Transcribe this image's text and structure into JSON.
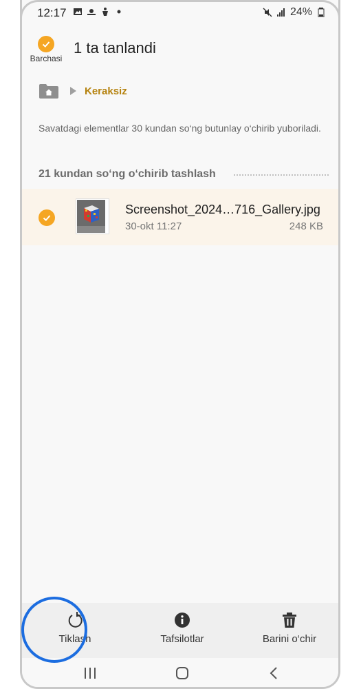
{
  "status_bar": {
    "time": "12:17",
    "battery": "24%",
    "left_icons": [
      "image-icon",
      "weather-icon",
      "accessibility-icon",
      "dot-icon"
    ],
    "right_icons": [
      "mute-icon",
      "signal-icon",
      "battery-icon"
    ]
  },
  "header": {
    "select_all_label": "Barchasi",
    "title": "1 ta tanlandi"
  },
  "breadcrumb": {
    "current": "Keraksiz"
  },
  "info_text": "Savatdagi elementlar 30 kundan so‘ng butunlay o‘chirib yuboriladi.",
  "section": {
    "heading": "21 kundan so‘ng o‘chirib tashlash"
  },
  "files": [
    {
      "name": "Screenshot_2024…716_Gallery.jpg",
      "date": "30-okt 11:27",
      "size": "248 KB",
      "selected": true
    }
  ],
  "actions": {
    "restore": "Tiklash",
    "details": "Tafsilotlar",
    "delete_all": "Barini o‘chir"
  },
  "colors": {
    "accent": "#f5a623",
    "breadcrumb": "#b5820e",
    "highlight": "#1c6de0",
    "selected_row": "#fbf4ea"
  }
}
